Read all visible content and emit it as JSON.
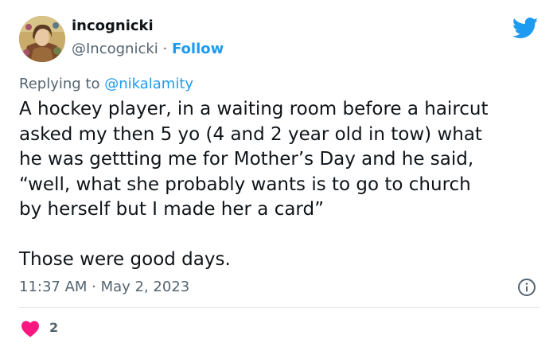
{
  "author": {
    "display_name": "incognicki",
    "handle": "@Incognicki",
    "separator": " · ",
    "follow_label": "Follow"
  },
  "reply": {
    "prefix": "Replying to ",
    "target": "@nikalamity"
  },
  "tweet": {
    "lines": [
      "A hockey player, in a waiting room before a haircut",
      "asked my then 5 yo (4 and 2 year old in tow) what",
      "he was gettting me for Mother’s Day and he said,",
      "“well, what she probably wants is to go to church",
      "by herself but I made her a card”",
      "Those were good days."
    ]
  },
  "timestamp": "11:37 AM · May 2, 2023",
  "likes": {
    "count": "2"
  },
  "icons": {
    "brand": "twitter-bird-icon",
    "info": "info-icon",
    "like": "heart-icon"
  },
  "colors": {
    "accent": "#1d9bf0",
    "secondary_text": "#536471",
    "primary_text": "#0f1419",
    "like": "#f91880",
    "divider": "#e3e7ea"
  }
}
